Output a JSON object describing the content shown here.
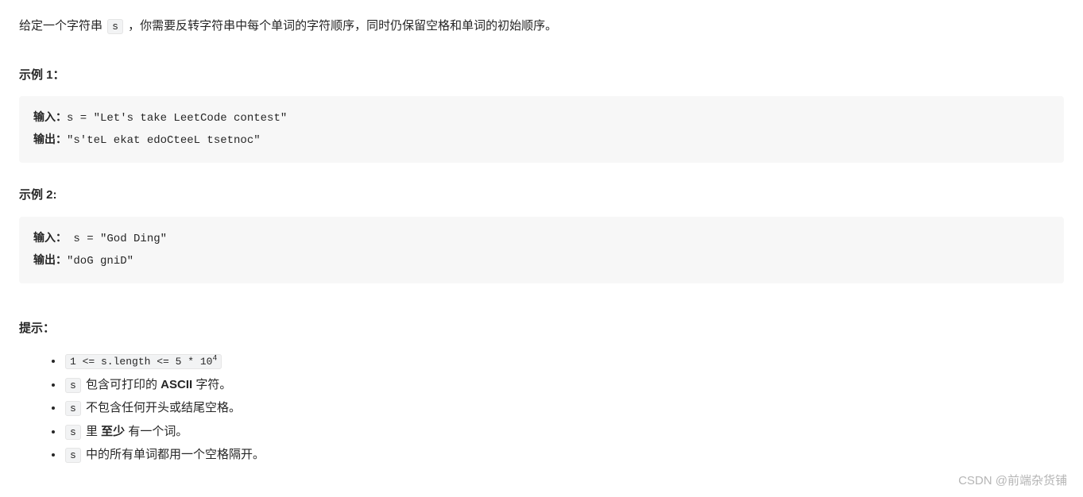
{
  "intro": {
    "prefix": "给定一个字符串 ",
    "codeToken": "s",
    "suffix": " ，你需要反转字符串中每个单词的字符顺序，同时仍保留空格和单词的初始顺序。"
  },
  "example1": {
    "heading": "示例 1：",
    "inputLabel": "输入：",
    "inputValue": "s = \"Let's take LeetCode contest\"",
    "outputLabel": "输出：",
    "outputValue": "\"s'teL ekat edoCteeL tsetnoc\""
  },
  "example2": {
    "heading": "示例 2:",
    "inputLabel": "输入：",
    "inputValue": " s = \"God Ding\"",
    "outputLabel": "输出：",
    "outputValue": "\"doG gniD\""
  },
  "hints": {
    "heading": "提示：",
    "item1": {
      "codeBefore": "1 <= s.length <= 5 * 10",
      "sup": "4"
    },
    "item2": {
      "code": "s",
      "textBefore": " 包含可打印的 ",
      "bold": "ASCII",
      "textAfter": " 字符。"
    },
    "item3": {
      "code": "s",
      "text": " 不包含任何开头或结尾空格。"
    },
    "item4": {
      "code": "s",
      "textBefore": " 里 ",
      "bold": "至少",
      "textAfter": " 有一个词。"
    },
    "item5": {
      "code": "s",
      "text": " 中的所有单词都用一个空格隔开。"
    }
  },
  "watermark": "CSDN @前端杂货铺"
}
